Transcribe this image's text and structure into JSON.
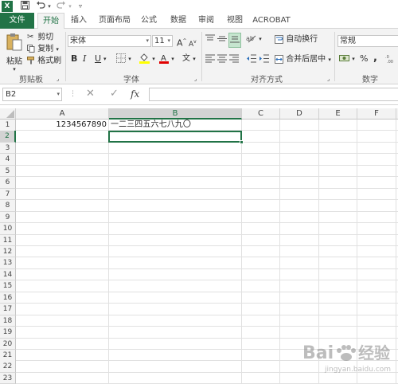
{
  "title_bar": {
    "excel_logo": "X",
    "quick_access": [
      "save-icon",
      "undo-icon",
      "redo-icon",
      "customize-icon"
    ]
  },
  "tabs": [
    {
      "label": "文件",
      "kind": "file"
    },
    {
      "label": "开始",
      "kind": "active"
    },
    {
      "label": "插入",
      "kind": ""
    },
    {
      "label": "页面布局",
      "kind": ""
    },
    {
      "label": "公式",
      "kind": ""
    },
    {
      "label": "数据",
      "kind": ""
    },
    {
      "label": "审阅",
      "kind": ""
    },
    {
      "label": "视图",
      "kind": ""
    },
    {
      "label": "ACROBAT",
      "kind": ""
    }
  ],
  "ribbon": {
    "clipboard": {
      "paste": "粘贴",
      "cut": "剪切",
      "copy": "复制",
      "format_painter": "格式刷",
      "label": "剪贴板"
    },
    "font": {
      "font_name": "宋体",
      "font_size": "11",
      "bold": "B",
      "italic": "I",
      "underline": "U",
      "label": "字体",
      "wen": "文",
      "inc": "A",
      "dec": "A"
    },
    "alignment": {
      "wrap_text": "自动换行",
      "merge_center": "合并后居中",
      "label": "对齐方式"
    },
    "number": {
      "format": "常规",
      "percent": "%",
      "comma": ",",
      "label": "数字"
    }
  },
  "formula_bar": {
    "name_box": "B2",
    "fx": "fx",
    "content": ""
  },
  "sheet": {
    "columns": [
      "A",
      "B",
      "C",
      "D",
      "E",
      "F"
    ],
    "rows": [
      "1",
      "2",
      "3",
      "4",
      "5",
      "6",
      "7",
      "8",
      "9",
      "10",
      "11",
      "12",
      "13",
      "14",
      "15",
      "16",
      "17",
      "18",
      "19",
      "20",
      "21",
      "22",
      "23"
    ],
    "cells": {
      "A1": "1234567890",
      "B1": "一二三四五六七八九〇"
    },
    "selected_cell": "B2"
  },
  "colors": {
    "accent": "#217346",
    "header_bg": "#f3f3f3",
    "selected_header": "#d3d3d3"
  },
  "watermark": {
    "brand": "Baidu",
    "text": "经验",
    "url": "jingyan.baidu.com"
  }
}
